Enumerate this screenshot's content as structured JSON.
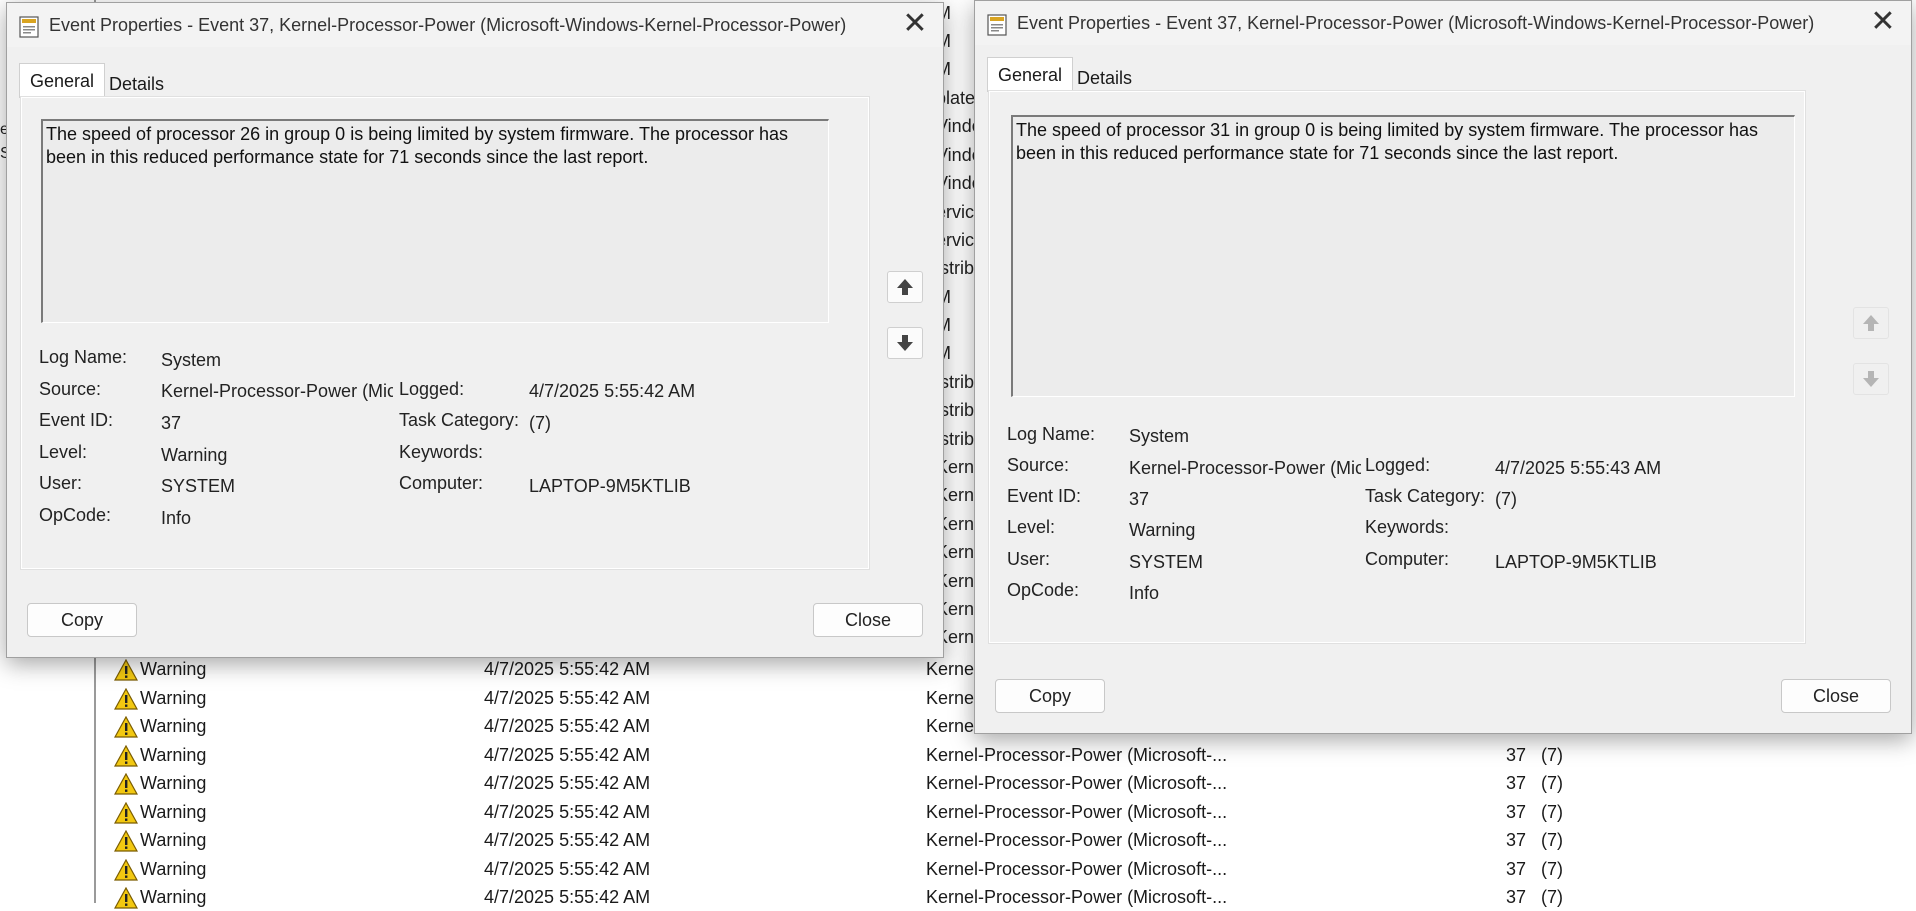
{
  "background": {
    "right_fragments": [
      "M",
      "M",
      "M",
      "plate",
      "Vindo",
      "Vindo",
      "Vindo",
      "ervic",
      "ervic",
      "istrib",
      "M",
      "M",
      "M",
      "istrib",
      "istrib",
      "istrib",
      "Kernel",
      "Kernel",
      "Kernel",
      "Kernel",
      "Kernel",
      "Kernel",
      "Kernel",
      "Kernel",
      "Kernel",
      "Kernel"
    ],
    "left_edge_fragments": [
      "e",
      "S"
    ],
    "rows": [
      {
        "level": "Warning",
        "datetime": "4/7/2025 5:55:42 AM",
        "source": "Kernel",
        "event_id": "",
        "category": ""
      },
      {
        "level": "Warning",
        "datetime": "4/7/2025 5:55:42 AM",
        "source": "Kernel",
        "event_id": "",
        "category": ""
      },
      {
        "level": "Warning",
        "datetime": "4/7/2025 5:55:42 AM",
        "source": "Kernel",
        "event_id": "",
        "category": ""
      },
      {
        "level": "Warning",
        "datetime": "4/7/2025 5:55:42 AM",
        "source": "Kernel-Processor-Power (Microsoft-...",
        "event_id": "37",
        "category": "(7)"
      },
      {
        "level": "Warning",
        "datetime": "4/7/2025 5:55:42 AM",
        "source": "Kernel-Processor-Power (Microsoft-...",
        "event_id": "37",
        "category": "(7)"
      },
      {
        "level": "Warning",
        "datetime": "4/7/2025 5:55:42 AM",
        "source": "Kernel-Processor-Power (Microsoft-...",
        "event_id": "37",
        "category": "(7)"
      },
      {
        "level": "Warning",
        "datetime": "4/7/2025 5:55:42 AM",
        "source": "Kernel-Processor-Power (Microsoft-...",
        "event_id": "37",
        "category": "(7)"
      },
      {
        "level": "Warning",
        "datetime": "4/7/2025 5:55:42 AM",
        "source": "Kernel-Processor-Power (Microsoft-...",
        "event_id": "37",
        "category": "(7)"
      },
      {
        "level": "Warning",
        "datetime": "4/7/2025 5:55:42 AM",
        "source": "Kernel-Processor-Power (Microsoft-...",
        "event_id": "37",
        "category": "(7)"
      }
    ]
  },
  "dialog_left": {
    "title": "Event Properties - Event 37, Kernel-Processor-Power (Microsoft-Windows-Kernel-Processor-Power)",
    "close_glyph": "✕",
    "tabs": [
      "General",
      "Details"
    ],
    "message": "The speed of processor 26 in group 0 is being limited by system firmware. The processor has been in this reduced performance state for 71 seconds since the last report.",
    "labels": {
      "log_name": "Log Name:",
      "source": "Source:",
      "event_id": "Event ID:",
      "level": "Level:",
      "user": "User:",
      "opcode": "OpCode:",
      "logged": "Logged:",
      "task_category": "Task Category:",
      "keywords": "Keywords:",
      "computer": "Computer:"
    },
    "values": {
      "log_name": "System",
      "source": "Kernel-Processor-Power (Mic",
      "event_id": "37",
      "level": "Warning",
      "user": "SYSTEM",
      "opcode": "Info",
      "logged": "4/7/2025 5:55:42 AM",
      "task_category": "(7)",
      "keywords": "",
      "computer": "LAPTOP-9M5KTLIB"
    },
    "copy_label": "Copy",
    "close_label": "Close"
  },
  "dialog_right": {
    "title": "Event Properties - Event 37, Kernel-Processor-Power (Microsoft-Windows-Kernel-Processor-Power)",
    "close_glyph": "✕",
    "tabs": [
      "General",
      "Details"
    ],
    "message": "The speed of processor 31 in group 0 is being limited by system firmware. The processor has been in this reduced performance state for 71 seconds since the last report.",
    "labels": {
      "log_name": "Log Name:",
      "source": "Source:",
      "event_id": "Event ID:",
      "level": "Level:",
      "user": "User:",
      "opcode": "OpCode:",
      "logged": "Logged:",
      "task_category": "Task Category:",
      "keywords": "Keywords:",
      "computer": "Computer:"
    },
    "values": {
      "log_name": "System",
      "source": "Kernel-Processor-Power (Mic",
      "event_id": "37",
      "level": "Warning",
      "user": "SYSTEM",
      "opcode": "Info",
      "logged": "4/7/2025 5:55:43 AM",
      "task_category": "(7)",
      "keywords": "",
      "computer": "LAPTOP-9M5KTLIB"
    },
    "copy_label": "Copy",
    "close_label": "Close"
  },
  "colors": {
    "warning_fill": "#f2c811",
    "dialog_bg": "#f0f0f0",
    "arrow_active": "#444444",
    "arrow_disabled": "#b5b5b5"
  }
}
